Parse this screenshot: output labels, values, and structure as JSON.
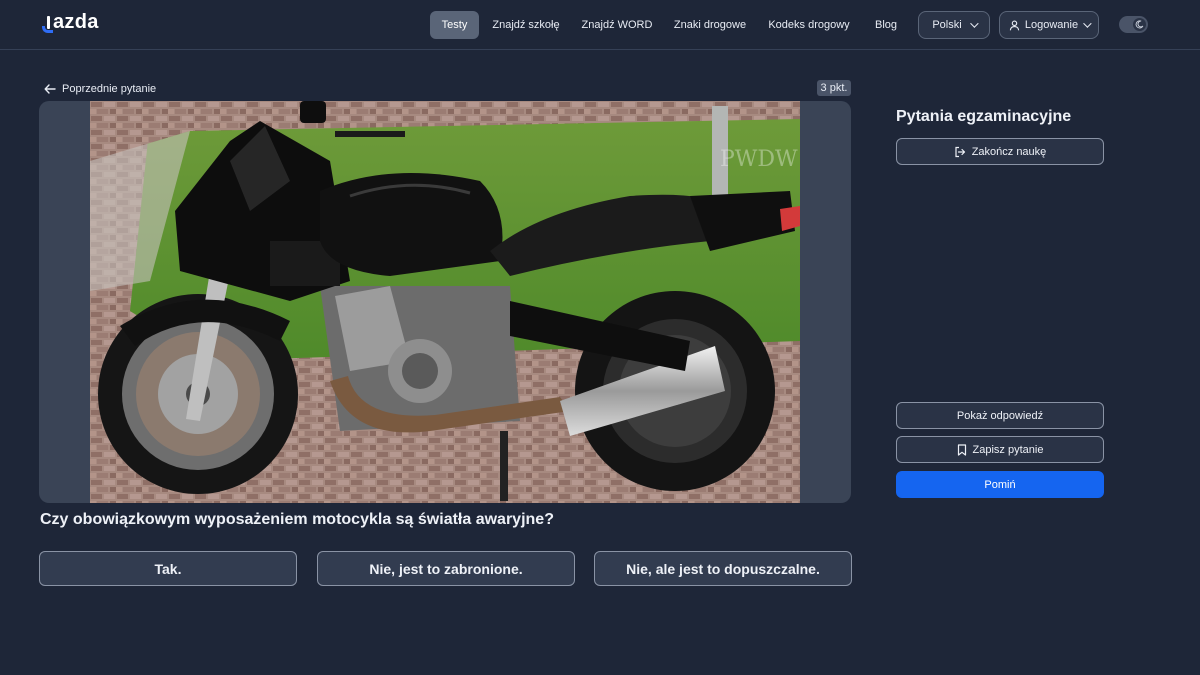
{
  "header": {
    "logo_text": "azda",
    "nav": [
      {
        "label": "Testy",
        "active": true
      },
      {
        "label": "Znajdź szkołę",
        "active": false
      },
      {
        "label": "Znajdź WORD",
        "active": false
      },
      {
        "label": "Znaki drogowe",
        "active": false
      },
      {
        "label": "Kodeks drogowy",
        "active": false
      },
      {
        "label": "Blog",
        "active": false
      }
    ],
    "language": "Polski",
    "login": "Logowanie",
    "theme_toggle": "dark"
  },
  "question_panel": {
    "back_label": "Poprzednie pytanie",
    "points": "3 pkt.",
    "question": "Czy obowiązkowym wyposażeniem motocykla są światła awaryjne?",
    "answers": [
      "Tak.",
      "Nie, jest to zabronione.",
      "Nie, ale jest to dopuszczalne."
    ],
    "image_watermark": "PWDW"
  },
  "sidebar": {
    "title": "Pytania egzaminacyjne",
    "finish_label": "Zakończ naukę",
    "show_answer_label": "Pokaż odpowiedź",
    "save_label": "Zapisz pytanie",
    "skip_label": "Pomiń"
  },
  "colors": {
    "background": "#1e2638",
    "primary": "#1565f0",
    "accent_logo": "#2f6df6"
  }
}
